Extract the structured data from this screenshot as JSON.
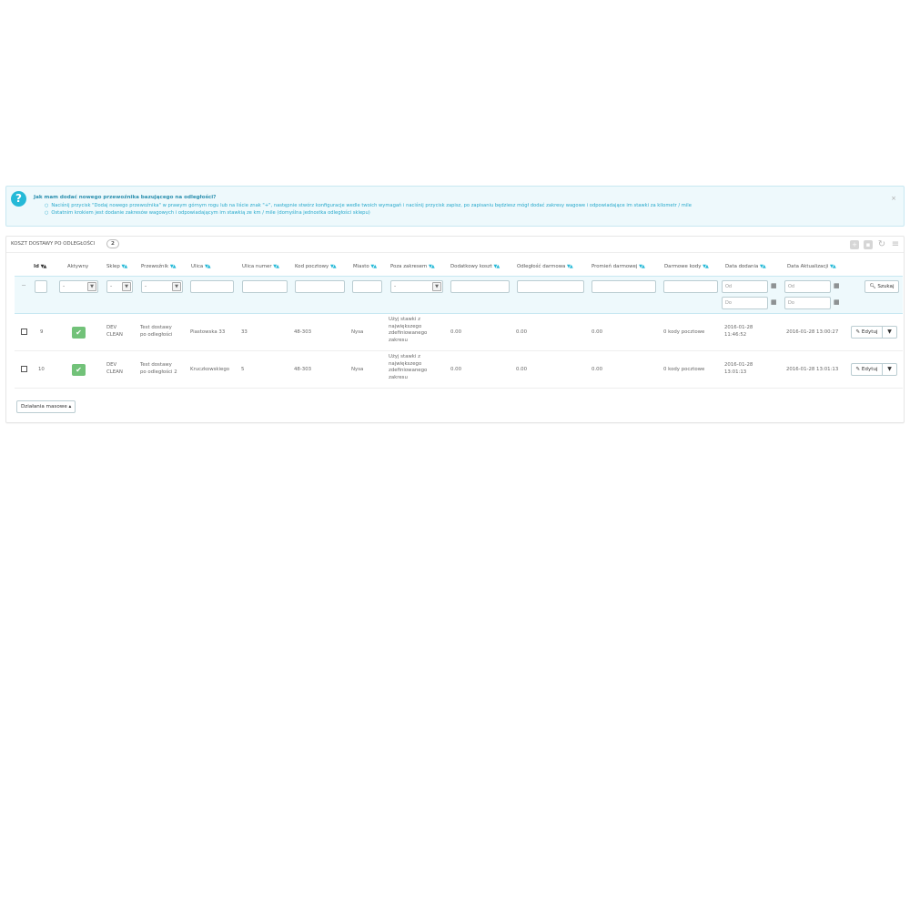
{
  "alert": {
    "icon": "question-circle-icon",
    "title": "Jak mam dodać nowego przewoźnika bazującego na odległości?",
    "lines": [
      "Naciśnij przycisk \"Dodaj nowego przewoźnika\" w prawym górnym rogu lub na liście znak \"+\", następnie stwórz konfiguracje wedle twoich wymagań i naciśnij przycisk zapisz, po zapisaniu będziesz mógł dodać zakresy wagowe i odpowiadające im stawki za kilometr / mile",
      "Ostatnim krokiem jest dodanie zakresów wagowych i odpowiadającym im stawkią ze km / mile (domyślna jednostka odległości sklepu)"
    ],
    "close": "×"
  },
  "panel": {
    "title": "KOSZT DOSTAWY PO ODLEGŁOŚCI",
    "count": "2"
  },
  "columns": {
    "id": "Id",
    "active": "Aktywny",
    "shop": "Sklep",
    "carrier": "Przewoźnik",
    "street": "Ulica",
    "street_number": "Ulica numer",
    "postcode": "Kod pocztowy",
    "city": "Miasto",
    "out_of_range": "Poza zakresem",
    "additional_cost": "Dodatkowy koszt",
    "free_distance": "Odległość darmowa",
    "free_radius": "Promień darmowej",
    "free_codes": "Darmowe kody",
    "date_add": "Data dodania",
    "date_upd": "Data Aktualizacji"
  },
  "sort_arrows": "▼▲",
  "filters": {
    "dash": "--",
    "select_default": "-",
    "from_placeholder": "Od",
    "to_placeholder": "Do",
    "search_label": "Szukaj"
  },
  "rows": [
    {
      "id": "9",
      "shop_line1": "DEV",
      "shop_line2": "CLEAN",
      "carrier_line1": "Test dostawy",
      "carrier_line2": "po odległości",
      "street": "Piastowska 33",
      "street_number": "33",
      "postcode": "48-303",
      "city": "Nysa",
      "out_of_range": [
        "Użyj stawki z",
        "największego",
        "zdefiniowanego",
        "zakresu"
      ],
      "additional_cost": "0.00",
      "free_distance": "0.00",
      "free_radius": "0.00",
      "free_codes": "0 kody pocztowe",
      "date_add_line1": "2016-01-28",
      "date_add_line2": "11:46:52",
      "date_upd": "2016-01-28 13:00:27",
      "edit_label": "Edytuj"
    },
    {
      "id": "10",
      "shop_line1": "DEV",
      "shop_line2": "CLEAN",
      "carrier_line1": "Test dostawy",
      "carrier_line2": "po odległości 2",
      "street": "Kruczkowskiego",
      "street_number": "5",
      "postcode": "48-303",
      "city": "Nysa",
      "out_of_range": [
        "Użyj stawki z",
        "największego",
        "zdefiniowanego",
        "zakresu"
      ],
      "additional_cost": "0.00",
      "free_distance": "0.00",
      "free_radius": "0.00",
      "free_codes": "0 kody pocztowe",
      "date_add_line1": "2016-01-28",
      "date_add_line2": "13:01:13",
      "date_upd": "2016-01-28 13:01:13",
      "edit_label": "Edytuj"
    }
  ],
  "bulk_actions": "Działania masowe ▴",
  "colors": {
    "accent": "#25b9d7",
    "active_green": "#72c279",
    "filter_bg": "#eef9fc"
  }
}
